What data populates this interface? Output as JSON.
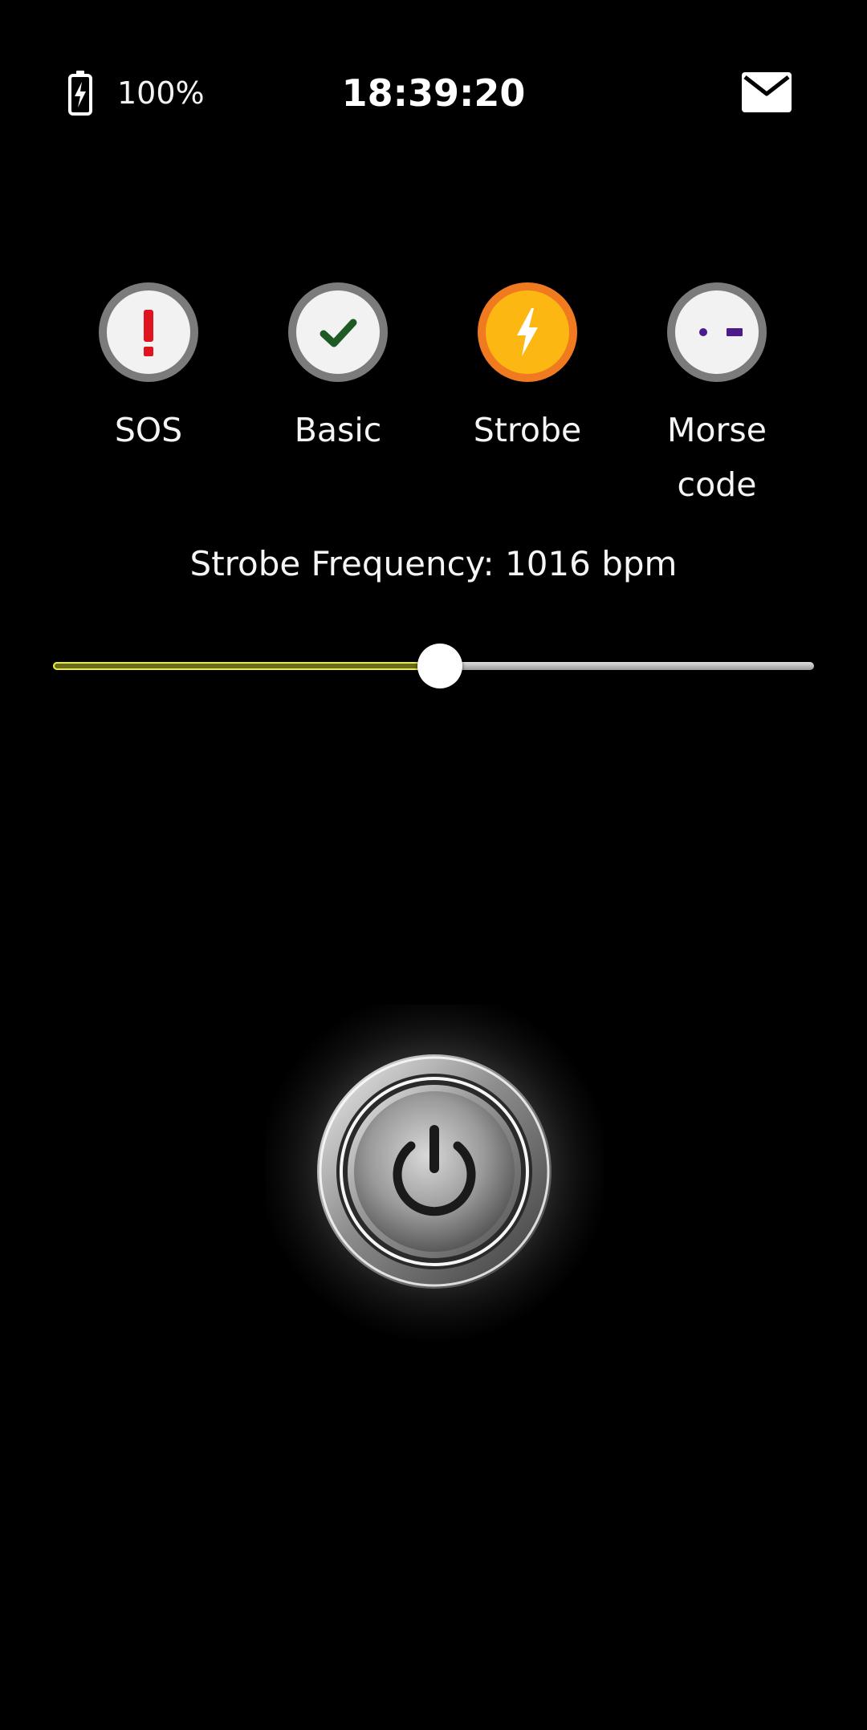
{
  "status_bar": {
    "battery_percent": "100%",
    "time": "18:39:20",
    "battery_icon": "battery-charging-icon",
    "mail_icon": "mail-icon"
  },
  "modes": [
    {
      "label": "SOS",
      "icon": "exclamation-icon",
      "selected": false,
      "icon_color": "#e0141e"
    },
    {
      "label": "Basic",
      "icon": "check-icon",
      "selected": false,
      "icon_color": "#1e5a24"
    },
    {
      "label": "Strobe",
      "icon": "lightning-icon",
      "selected": true,
      "icon_color": "#ffffff"
    },
    {
      "label": "Morse\ncode",
      "icon": "morse-icon",
      "selected": false,
      "icon_color": "#4b1a8c"
    }
  ],
  "strobe": {
    "frequency_text": "Strobe Frequency: 1016 bpm",
    "slider_fraction": 0.508
  },
  "power_button": {
    "icon": "power-icon"
  },
  "colors": {
    "background": "#000000",
    "selected_ring": "#f07a20",
    "selected_fill": "#fdb712",
    "unselected_ring": "#7b7b7b",
    "slider_fill_border": "#e8ee3a"
  }
}
